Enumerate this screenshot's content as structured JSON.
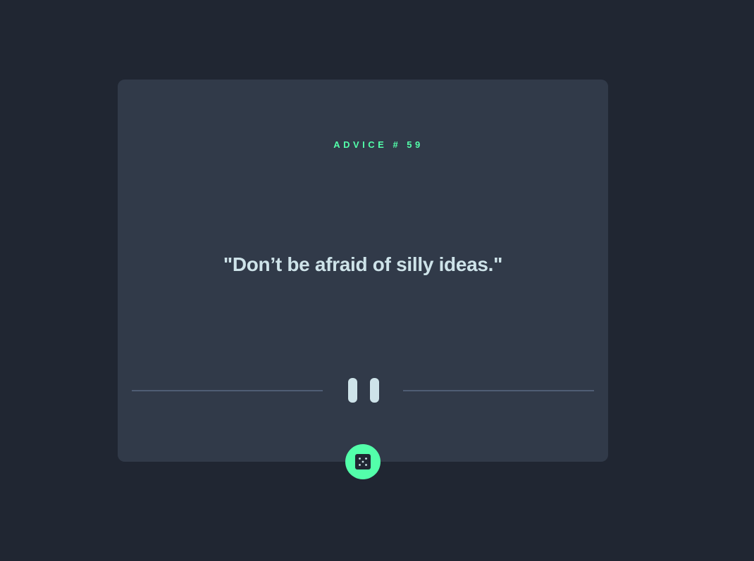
{
  "advice": {
    "label": "ADVICE # 59",
    "text": "\"Don’t be afraid of silly ideas.\""
  },
  "divider": {
    "icon": "pause-icon"
  },
  "dice_button": {
    "icon": "dice-icon"
  },
  "colors": {
    "background": "#202632",
    "card": "#313a49",
    "accent": "#53ffaa",
    "text": "#cee3e9",
    "divider": "#4f5d74"
  }
}
